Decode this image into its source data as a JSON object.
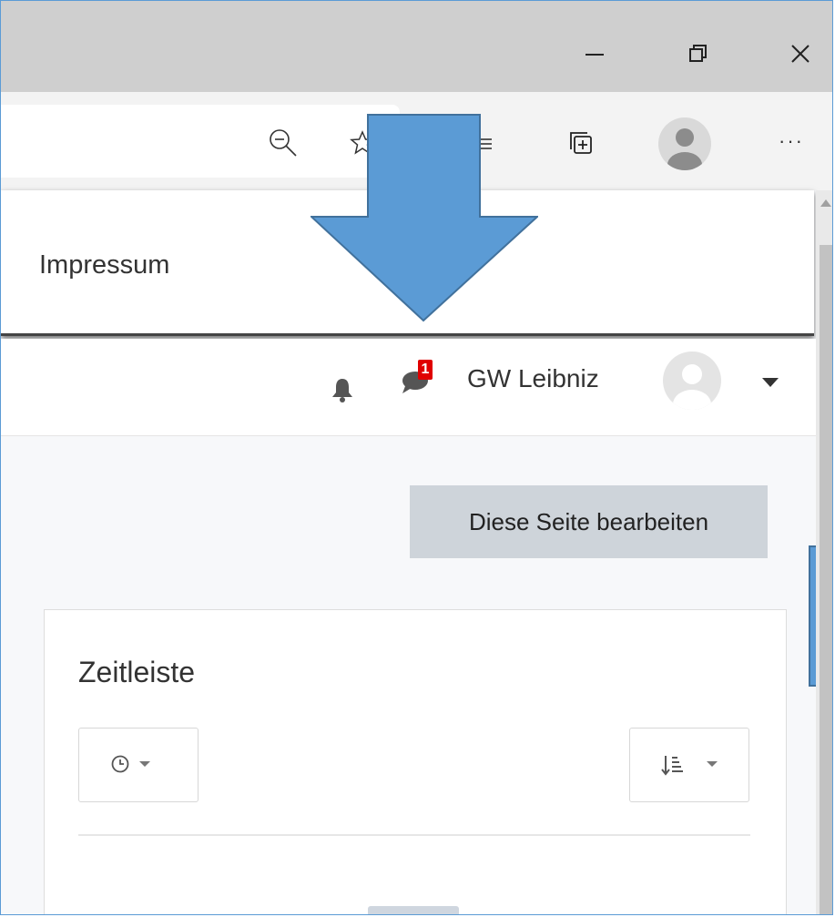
{
  "window": {
    "controls": {
      "minimize": "minimize-icon",
      "maximize": "restore-icon",
      "close": "close-icon"
    }
  },
  "toolbar": {
    "icons": [
      "zoom-out-icon",
      "favorite-star-icon",
      "reading-list-icon",
      "collections-icon",
      "profile-avatar-icon",
      "more-menu-icon"
    ],
    "more_label": "···"
  },
  "menu": {
    "impressum_label": "Impressum"
  },
  "navbar": {
    "message_count": "1",
    "username": "GW Leibniz",
    "icons": [
      "notification-bell-icon",
      "messages-chat-icon",
      "user-menu-caret-icon"
    ]
  },
  "main": {
    "edit_button_label": "Diese Seite bearbeiten"
  },
  "timeline": {
    "title": "Zeitleiste",
    "filter_icon": "clock-icon",
    "sort_icon": "sort-list-icon"
  },
  "colors": {
    "annotation_arrow": "#5b9bd5",
    "annotation_stroke": "#41719c",
    "badge": "#e00000",
    "button_bg": "#ced4da"
  }
}
